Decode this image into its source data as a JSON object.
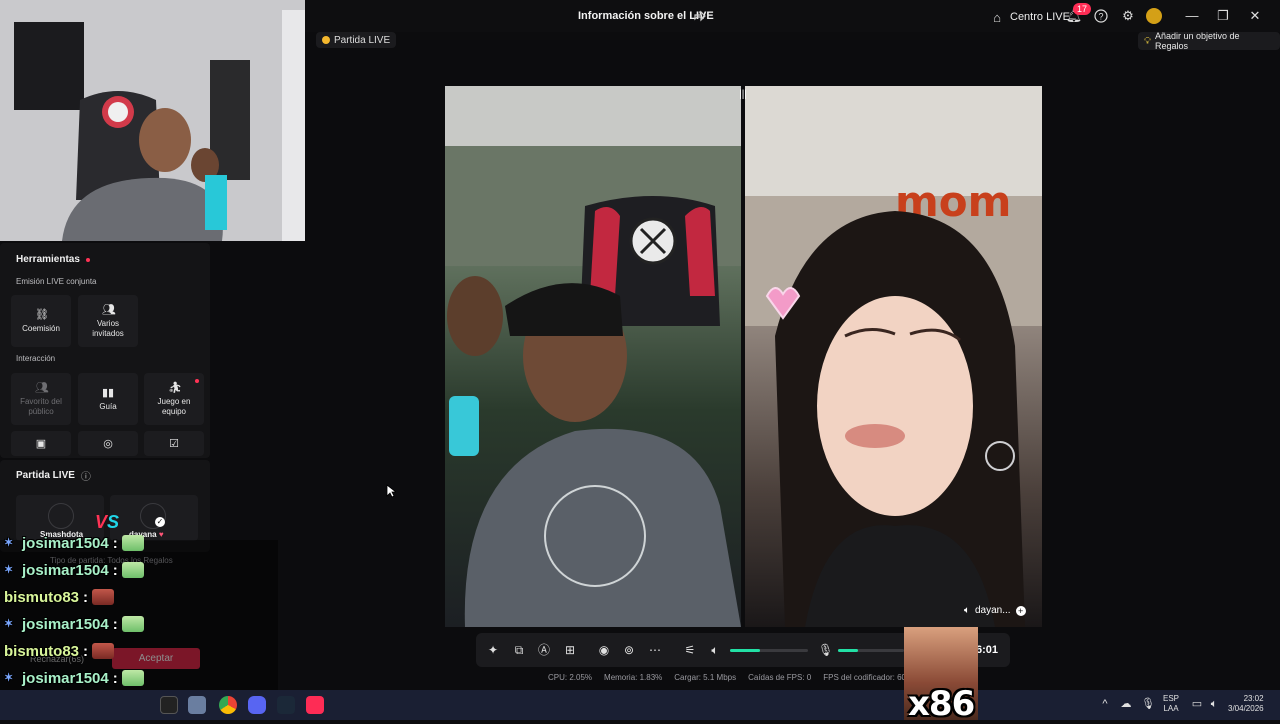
{
  "header": {
    "title": "Información sobre el LIVE",
    "centro_label": "Centro LIVE",
    "notification_count": "17",
    "partida_label": "Partida LIVE",
    "objective_label": "Añadir un objetivo de Regalos"
  },
  "tools": {
    "title": "Herramientas",
    "section_cohost": "Emisión LIVE conjunta",
    "cohost_items": [
      {
        "label": "Coemisión",
        "icon": "link-icon"
      },
      {
        "label": "Varios\ninvitados",
        "icon": "users-icon"
      }
    ],
    "section_interaction": "Interacción",
    "interaction_items": [
      {
        "label": "Favorito del\npúblico",
        "icon": "people-icon",
        "disabled": true
      },
      {
        "label": "Guía",
        "icon": "guide-icon",
        "disabled": false
      },
      {
        "label": "Juego en\nequipo",
        "icon": "team-game-icon",
        "disabled": false
      }
    ]
  },
  "partida": {
    "title": "Partida LIVE",
    "player1": "Smashdota",
    "player2": "dayana",
    "vs": "VS",
    "match_type": "Tipo de partida: Todos los Regalos",
    "reject_label": "Rechazar(6s)",
    "accept_label": "Aceptar"
  },
  "chat": [
    {
      "user": "josimar1504",
      "emote": "green"
    },
    {
      "user": "josimar1504",
      "emote": "green"
    },
    {
      "user": "bismuto83",
      "emote": "face"
    },
    {
      "user": "josimar1504",
      "emote": "green"
    },
    {
      "user": "bismuto83",
      "emote": "face"
    },
    {
      "user": "josimar1504",
      "emote": "green"
    },
    {
      "user": "josimar1504",
      "emote": "green"
    }
  ],
  "guest": {
    "name": "dayan..."
  },
  "controls": {
    "timer": "6:01",
    "volume_level": 0.38,
    "mic_level": 0.3
  },
  "stats": {
    "cpu": "CPU: 2.05%",
    "memory": "Memoria: 1.83%",
    "upload": "Cargar: 5.1 Mbps",
    "fps_drops": "Caídas de FPS: 0",
    "encoder_fps": "FPS del codificador: 60"
  },
  "meme_text": "x86",
  "taskbar": {
    "lang_top": "ESP",
    "lang_bottom": "LAA",
    "time": "23:02",
    "date": "3/04/2026"
  },
  "colors": {
    "accent": "#22e0a5",
    "badge": "#ff2d55",
    "vs_red": "#ff3355",
    "vs_cyan": "#20d6e8"
  }
}
